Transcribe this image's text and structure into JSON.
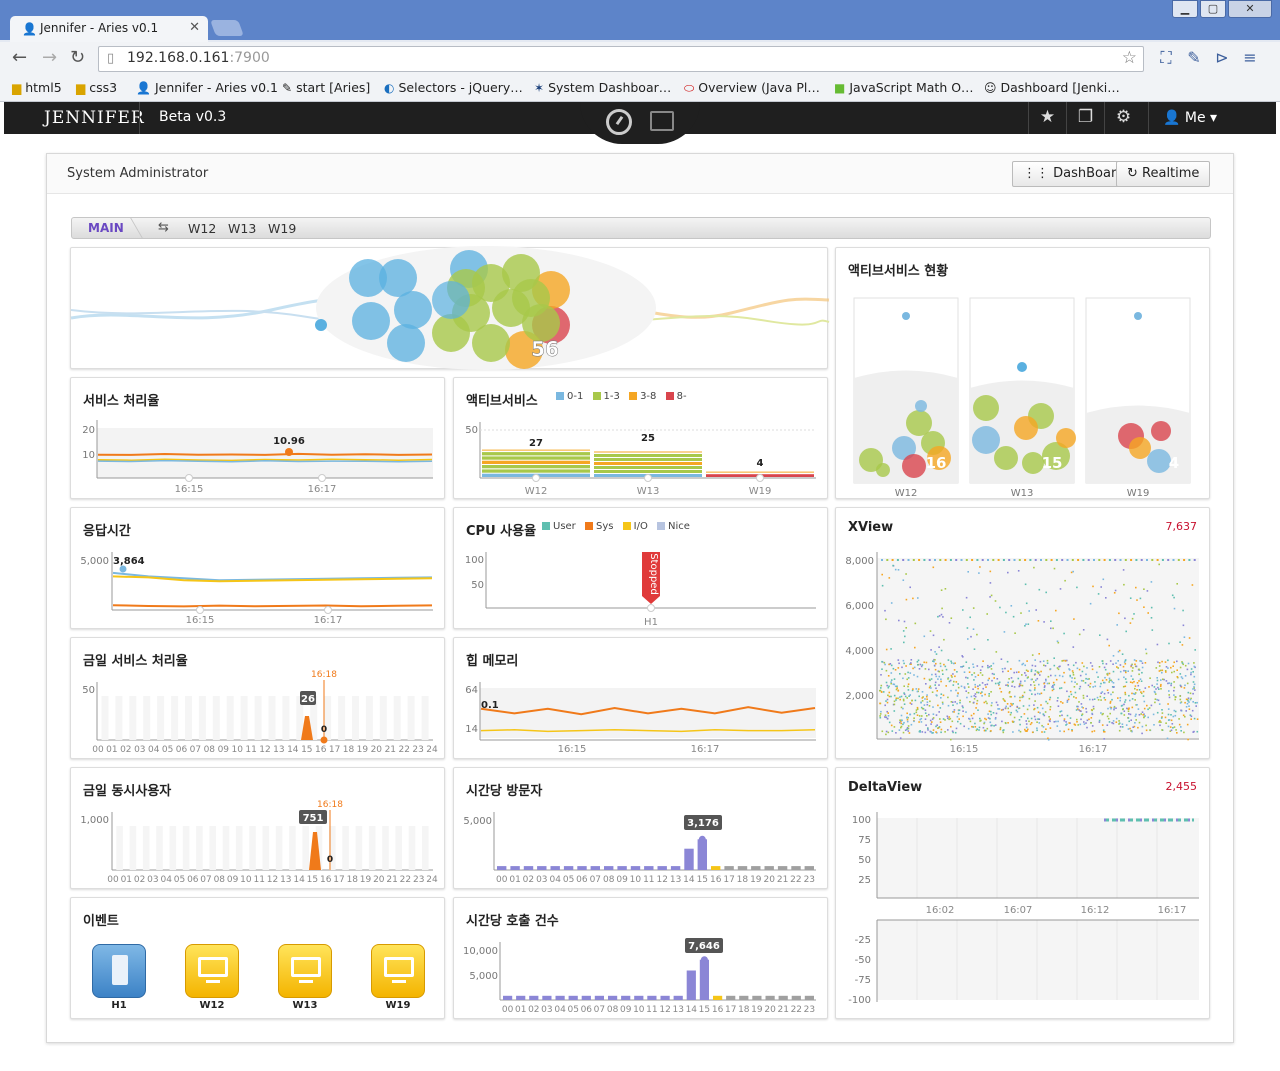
{
  "browser": {
    "tab_title": "Jennifer - Aries v0.1",
    "url_host": "192.168.0.161",
    "url_port": ":7900",
    "bookmarks": [
      "html5",
      "css3",
      "Jennifer - Aries v0.1",
      "start [Aries]",
      "Selectors - jQuery…",
      "System Dashboar…",
      "Overview (Java Pl…",
      "JavaScript Math O…",
      "Dashboard [Jenki…"
    ]
  },
  "app": {
    "logo": "JENNIFER",
    "version": "Beta v0.3",
    "user": "Me"
  },
  "header": {
    "title": "System Administrator",
    "dashboard_btn": "DashBoard",
    "realtime_btn": "Realtime"
  },
  "breadcrumb": {
    "main": "MAIN",
    "items": [
      "W12",
      "W13",
      "W19"
    ]
  },
  "panels": {
    "equalizer": {
      "count": "56"
    },
    "active_status": {
      "title": "액티브서비스 현황",
      "counts": [
        "16",
        "15",
        "4"
      ],
      "labels": [
        "W12",
        "W13",
        "W19"
      ]
    },
    "throughput": {
      "title": "서비스 처리율",
      "label": "10.96"
    },
    "active_service": {
      "title": "액티브서비스",
      "legend": [
        "0-1",
        "1-3",
        "3-8",
        "8-"
      ],
      "values": [
        "27",
        "25",
        "4"
      ],
      "labels": [
        "W12",
        "W13",
        "W19"
      ]
    },
    "response": {
      "title": "응답시간",
      "label": "3,864"
    },
    "cpu": {
      "title": "CPU 사용율",
      "legend": [
        "User",
        "Sys",
        "I/O",
        "Nice"
      ],
      "stopped": "Stopped",
      "label": "H1"
    },
    "xview": {
      "title": "XView",
      "count": "7,637"
    },
    "today_throughput": {
      "title": "금일 서비스 처리율",
      "peak": "26",
      "now": "0",
      "time": "16:18"
    },
    "heap": {
      "title": "힙 메모리",
      "label": "0.1"
    },
    "today_users": {
      "title": "금일 동시사용자",
      "peak": "751",
      "now": "0",
      "time": "16:18"
    },
    "visitors": {
      "title": "시간당 방문자",
      "peak": "3,176"
    },
    "deltaview": {
      "title": "DeltaView",
      "count": "2,455"
    },
    "events": {
      "title": "이벤트",
      "items": [
        "H1",
        "W12",
        "W13",
        "W19"
      ]
    },
    "calls": {
      "title": "시간당 호출 건수",
      "peak": "7,646"
    }
  },
  "colors": {
    "orange": "#f07a1a",
    "yellow": "#f5c518",
    "blue": "#7ab8e0",
    "green": "#a8c84a",
    "red": "#d9454d",
    "purple": "#8b86d6",
    "gray": "#a0a0a0",
    "teal": "#5fbfb0"
  },
  "chart_data": [
    {
      "type": "line",
      "title": "서비스 처리율",
      "x": [
        "16:15",
        "16:17"
      ],
      "ylim": [
        0,
        25
      ],
      "yticks": [
        10,
        20
      ],
      "series": [
        {
          "values": [
            10.6,
            10.5,
            10.9,
            10.6,
            10.7,
            10.5,
            10.96,
            10.6,
            10.8,
            10.5,
            10.7
          ]
        },
        {
          "values": [
            8.3,
            8.1,
            8.5,
            8.2,
            8.0,
            8.4,
            8.2,
            8.5,
            8.3,
            8.1,
            8.4
          ]
        },
        {
          "values": [
            7.7,
            7.5,
            7.9,
            7.6,
            7.4,
            7.8,
            7.5,
            7.7,
            7.6,
            7.4,
            7.6
          ]
        }
      ]
    },
    {
      "type": "bar",
      "title": "액티브서비스",
      "categories": [
        "W12",
        "W13",
        "W19"
      ],
      "values": [
        27,
        25,
        4
      ],
      "ylim": [
        0,
        50
      ],
      "yticks": [
        50
      ]
    },
    {
      "type": "line",
      "title": "응답시간",
      "x": [
        "16:15",
        "16:17"
      ],
      "yticks": [
        5000
      ],
      "series": [
        {
          "values": [
            3864,
            3500,
            3300,
            3100,
            3150,
            3200,
            3250,
            3300,
            3350,
            3400
          ]
        },
        {
          "values": [
            3500,
            3400,
            3100,
            3000,
            3050,
            3100,
            3150,
            3200,
            3250,
            3300
          ]
        },
        {
          "values": [
            500,
            420,
            380,
            460,
            400,
            430,
            470,
            390,
            450,
            480
          ]
        }
      ]
    },
    {
      "type": "bar",
      "title": "CPU 사용율",
      "categories": [
        "H1"
      ],
      "yticks": [
        50,
        100
      ]
    },
    {
      "type": "scatter",
      "title": "XView",
      "x": [
        "16:15",
        "16:17"
      ],
      "yticks": [
        2000,
        4000,
        6000,
        8000
      ],
      "ylim": [
        0,
        8000
      ]
    },
    {
      "type": "bar",
      "title": "금일 서비스 처리율",
      "categories": [
        "00",
        "01",
        "02",
        "03",
        "04",
        "05",
        "06",
        "07",
        "08",
        "09",
        "10",
        "11",
        "12",
        "13",
        "14",
        "15",
        "16",
        "17",
        "18",
        "19",
        "20",
        "21",
        "22",
        "23",
        "24"
      ],
      "values": [
        0,
        0,
        0,
        0,
        0,
        0,
        0,
        0,
        0,
        0,
        0,
        0,
        0,
        0,
        0,
        26,
        0,
        0,
        0,
        0,
        0,
        0,
        0,
        0,
        0
      ],
      "yticks": [
        50
      ]
    },
    {
      "type": "line",
      "title": "힙 메모리",
      "x": [
        "16:15",
        "16:17"
      ],
      "yticks": [
        14,
        64
      ],
      "series": [
        {
          "values": [
            40,
            34,
            40,
            33,
            41,
            34,
            40,
            34,
            42,
            35,
            41
          ]
        },
        {
          "values": [
            12,
            13,
            11,
            12,
            13,
            12,
            11,
            13,
            12,
            12,
            13
          ]
        }
      ]
    },
    {
      "type": "bar",
      "title": "금일 동시사용자",
      "categories": [
        "00",
        "01",
        "02",
        "03",
        "04",
        "05",
        "06",
        "07",
        "08",
        "09",
        "10",
        "11",
        "12",
        "13",
        "14",
        "15",
        "16",
        "17",
        "18",
        "19",
        "20",
        "21",
        "22",
        "23",
        "24"
      ],
      "values": [
        0,
        0,
        0,
        0,
        0,
        0,
        0,
        0,
        0,
        0,
        0,
        0,
        0,
        0,
        0,
        751,
        0,
        0,
        0,
        0,
        0,
        0,
        0,
        0,
        0
      ],
      "yticks": [
        1000
      ]
    },
    {
      "type": "bar",
      "title": "시간당 방문자",
      "categories": [
        "00",
        "01",
        "02",
        "03",
        "04",
        "05",
        "06",
        "07",
        "08",
        "09",
        "10",
        "11",
        "12",
        "13",
        "14",
        "15",
        "16",
        "17",
        "18",
        "19",
        "20",
        "21",
        "22",
        "23"
      ],
      "values": [
        400,
        400,
        400,
        400,
        400,
        400,
        400,
        400,
        400,
        400,
        400,
        400,
        400,
        400,
        2200,
        3176,
        400,
        400,
        400,
        400,
        400,
        400,
        400,
        400
      ],
      "yticks": [
        5000
      ]
    },
    {
      "type": "line",
      "title": "DeltaView",
      "x": [
        "16:02",
        "16:07",
        "16:12",
        "16:17"
      ],
      "yticks": [
        25,
        50,
        75,
        100,
        -25,
        -50,
        -75,
        -100
      ]
    },
    {
      "type": "bar",
      "title": "시간당 호출 건수",
      "categories": [
        "00",
        "01",
        "02",
        "03",
        "04",
        "05",
        "06",
        "07",
        "08",
        "09",
        "10",
        "11",
        "12",
        "13",
        "14",
        "15",
        "16",
        "17",
        "18",
        "19",
        "20",
        "21",
        "22",
        "23"
      ],
      "values": [
        800,
        800,
        800,
        800,
        800,
        800,
        800,
        800,
        800,
        800,
        800,
        800,
        800,
        800,
        5600,
        7646,
        800,
        800,
        800,
        800,
        800,
        800,
        800,
        800
      ],
      "yticks": [
        5000,
        10000
      ]
    }
  ]
}
